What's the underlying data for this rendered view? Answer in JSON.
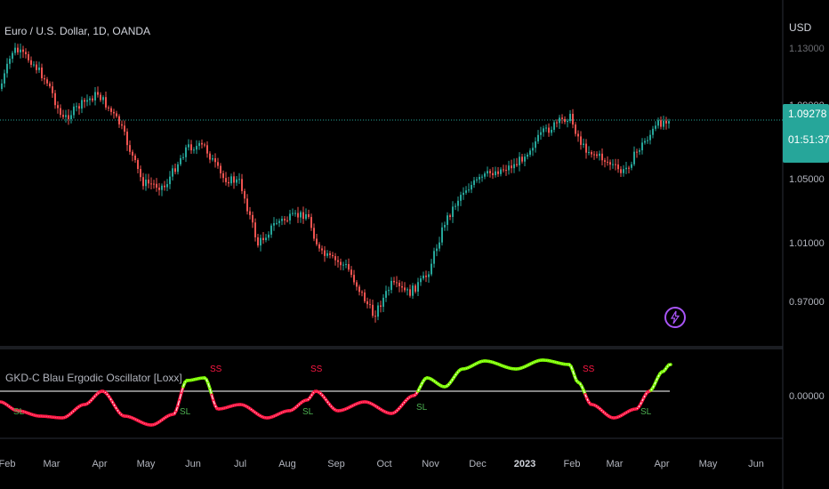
{
  "header": {
    "symbol_title": "Euro / U.S. Dollar, 1D, OANDA",
    "currency": "USD"
  },
  "price_axis": {
    "ticks": [
      "1.13000",
      "1.09000",
      "1.05000",
      "1.01000",
      "0.97000"
    ],
    "last_price": "1.09278",
    "countdown": "01:51:37"
  },
  "oscillator": {
    "title": "GKD-C Blau Ergodic Oscillator [Loxx]",
    "zero_tick": "0.00000",
    "markers": {
      "sell": "SS",
      "long": "SL"
    }
  },
  "time_axis": {
    "labels": [
      "Feb",
      "Mar",
      "Apr",
      "May",
      "Jun",
      "Jul",
      "Aug",
      "Sep",
      "Oct",
      "Nov",
      "Dec",
      "2023",
      "Feb",
      "Mar",
      "Apr",
      "May",
      "Jun"
    ]
  },
  "colors": {
    "up": "#26a69a",
    "down": "#ef5350",
    "osc_bull": "#7cfc00",
    "osc_bear": "#ff1744",
    "accent": "#26a69a",
    "alert": "#a855f7"
  },
  "icons": {
    "alert": "lightning-icon"
  }
}
